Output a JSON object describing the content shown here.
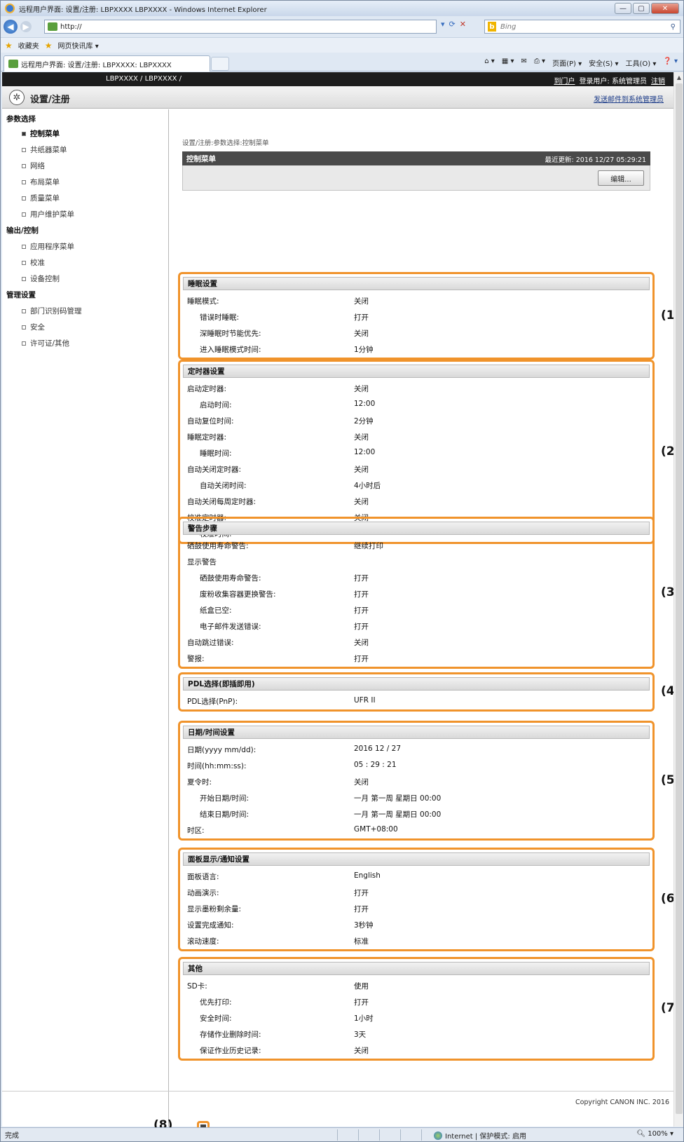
{
  "browser": {
    "title": "远程用户界面: 设置/注册: LBPXXXX LBPXXXX - Windows Internet Explorer",
    "url": "http://",
    "search_placeholder": "Bing",
    "favorites_label": "收藏夹",
    "quick_links_label": "网页快讯库 ▾",
    "tab_title": "远程用户界面: 设置/注册: LBPXXXX: LBPXXXX",
    "cmd_items": [
      "页面(P) ▾",
      "安全(S) ▾",
      "工具(O) ▾"
    ],
    "status_left": "完成",
    "status_zone": "Internet | 保护模式: 启用",
    "status_zoom": "100%"
  },
  "topband": {
    "device": "LBPXXXX / LBPXXXX /",
    "links": [
      "到门户",
      "登录用户: 系统管理员",
      "注销"
    ]
  },
  "header": {
    "title": "设置/注册",
    "mail_link": "发送邮件到系统管理员"
  },
  "sidebar": {
    "groups": [
      {
        "label": "参数选择",
        "items": [
          "控制菜单",
          "共纸器菜单",
          "网络",
          "布局菜单",
          "质量菜单",
          "用户维护菜单"
        ]
      },
      {
        "label": "输出/控制",
        "items": [
          "应用程序菜单",
          "校准",
          "设备控制"
        ]
      },
      {
        "label": "管理设置",
        "items": [
          "部门识别码管理",
          "安全",
          "许可证/其他"
        ]
      }
    ]
  },
  "main": {
    "breadcrumb": "设置/注册:参数选择:控制菜单",
    "panel_title": "控制菜单",
    "last_updated": "最近更新: 2016 12/27 05:29:21",
    "edit_button": "编辑...",
    "copyright": "Copyright CANON INC. 2016"
  },
  "sections": [
    {
      "title": "睡眠设置",
      "callout": "(1",
      "rows": [
        {
          "label": "睡眠模式:",
          "value": "关闭",
          "indent": 0
        },
        {
          "label": "错误时睡眠:",
          "value": "打开",
          "indent": 1
        },
        {
          "label": "深睡眠时节能优先:",
          "value": "关闭",
          "indent": 1
        },
        {
          "label": "进入睡眠模式时间:",
          "value": "1分钟",
          "indent": 1
        }
      ]
    },
    {
      "title": "定时器设置",
      "callout": "(2",
      "rows": [
        {
          "label": "启动定时器:",
          "value": "关闭",
          "indent": 0
        },
        {
          "label": "启动时间:",
          "value": "12:00",
          "indent": 1
        },
        {
          "label": "自动复位时间:",
          "value": "2分钟",
          "indent": 0
        },
        {
          "label": "睡眠定时器:",
          "value": "关闭",
          "indent": 0
        },
        {
          "label": "睡眠时间:",
          "value": "12:00",
          "indent": 1
        },
        {
          "label": "自动关闭定时器:",
          "value": "关闭",
          "indent": 0
        },
        {
          "label": "自动关闭时间:",
          "value": "4小时后",
          "indent": 1
        },
        {
          "label": "自动关闭每周定时器:",
          "value": "关闭",
          "indent": 0
        },
        {
          "label": "校准定时器:",
          "value": "关闭",
          "indent": 0
        },
        {
          "label": "校准时间:",
          "value": "12:00",
          "indent": 1
        }
      ]
    },
    {
      "title": "警告步骤",
      "callout": "(3",
      "rows": [
        {
          "label": "硒鼓使用寿命警告:",
          "value": "继续打印",
          "indent": 0
        },
        {
          "label": "显示警告",
          "value": "",
          "indent": 0
        },
        {
          "label": "硒鼓使用寿命警告:",
          "value": "打开",
          "indent": 1
        },
        {
          "label": "废粉收集容器更换警告:",
          "value": "打开",
          "indent": 1
        },
        {
          "label": "纸盒已空:",
          "value": "打开",
          "indent": 1
        },
        {
          "label": "电子邮件发送错误:",
          "value": "打开",
          "indent": 1
        },
        {
          "label": "自动跳过错误:",
          "value": "关闭",
          "indent": 0
        },
        {
          "label": "警报:",
          "value": "打开",
          "indent": 0
        }
      ]
    },
    {
      "title": "PDL选择(即插即用)",
      "callout": "(4",
      "rows": [
        {
          "label": "PDL选择(PnP):",
          "value": "UFR II",
          "indent": 0
        }
      ]
    },
    {
      "title": "日期/时间设置",
      "callout": "(5",
      "rows": [
        {
          "label": "日期(yyyy mm/dd):",
          "value": "2016 12 / 27",
          "indent": 0
        },
        {
          "label": "时间(hh:mm:ss):",
          "value": "05 : 29 : 21",
          "indent": 0
        },
        {
          "label": "夏令时:",
          "value": "关闭",
          "indent": 0
        },
        {
          "label": "开始日期/时间:",
          "value": "一月 第一周 星期日 00:00",
          "indent": 1
        },
        {
          "label": "结束日期/时间:",
          "value": "一月 第一周 星期日 00:00",
          "indent": 1
        },
        {
          "label": "时区:",
          "value": "GMT+08:00",
          "indent": 0
        }
      ]
    },
    {
      "title": "面板显示/通知设置",
      "callout": "(6",
      "rows": [
        {
          "label": "面板语言:",
          "value": "English",
          "indent": 0
        },
        {
          "label": "动画演示:",
          "value": "打开",
          "indent": 0
        },
        {
          "label": "显示墨粉剩余量:",
          "value": "打开",
          "indent": 0
        },
        {
          "label": "设置完成通知:",
          "value": "3秒钟",
          "indent": 0
        },
        {
          "label": "滚动速度:",
          "value": "标准",
          "indent": 0
        }
      ]
    },
    {
      "title": "其他",
      "callout": "(7",
      "rows": [
        {
          "label": "SD卡:",
          "value": "使用",
          "indent": 0
        },
        {
          "label": "优先打印:",
          "value": "打开",
          "indent": 1
        },
        {
          "label": "安全时间:",
          "value": "1小时",
          "indent": 1
        },
        {
          "label": "存储作业删除时间:",
          "value": "3天",
          "indent": 1
        },
        {
          "label": "保证作业历史记录:",
          "value": "关闭",
          "indent": 1
        }
      ]
    }
  ],
  "bottom_callout": "(8)"
}
